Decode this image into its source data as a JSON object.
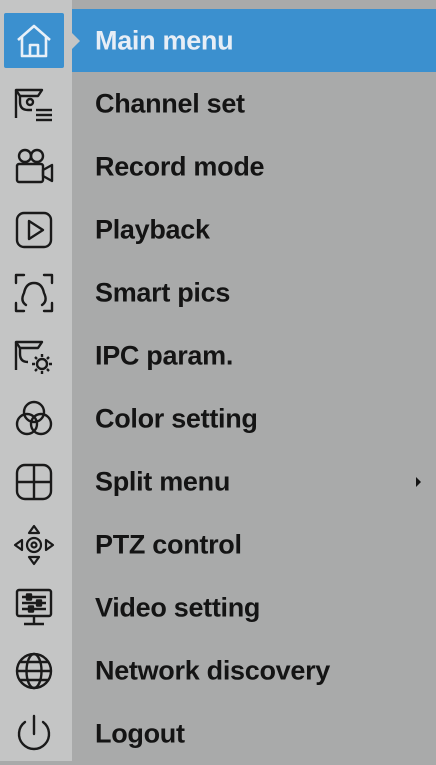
{
  "menu": {
    "items": [
      {
        "label": "Main menu",
        "icon": "home-icon",
        "active": true
      },
      {
        "label": "Channel set",
        "icon": "camera-channel-icon"
      },
      {
        "label": "Record mode",
        "icon": "video-camera-icon"
      },
      {
        "label": "Playback",
        "icon": "play-icon"
      },
      {
        "label": "Smart pics",
        "icon": "face-frame-icon"
      },
      {
        "label": "IPC param.",
        "icon": "camera-gear-icon"
      },
      {
        "label": "Color setting",
        "icon": "color-circles-icon"
      },
      {
        "label": "Split menu",
        "icon": "split-grid-icon",
        "has_submenu": true
      },
      {
        "label": "PTZ control",
        "icon": "ptz-arrows-icon"
      },
      {
        "label": "Video setting",
        "icon": "monitor-sliders-icon"
      },
      {
        "label": "Network discovery",
        "icon": "globe-icon"
      },
      {
        "label": "Logout",
        "icon": "power-icon"
      }
    ]
  },
  "colors": {
    "highlight": "#3b90cf",
    "background": "#a9aaaa",
    "icon_column": "#c4c5c5",
    "text": "#141414"
  }
}
